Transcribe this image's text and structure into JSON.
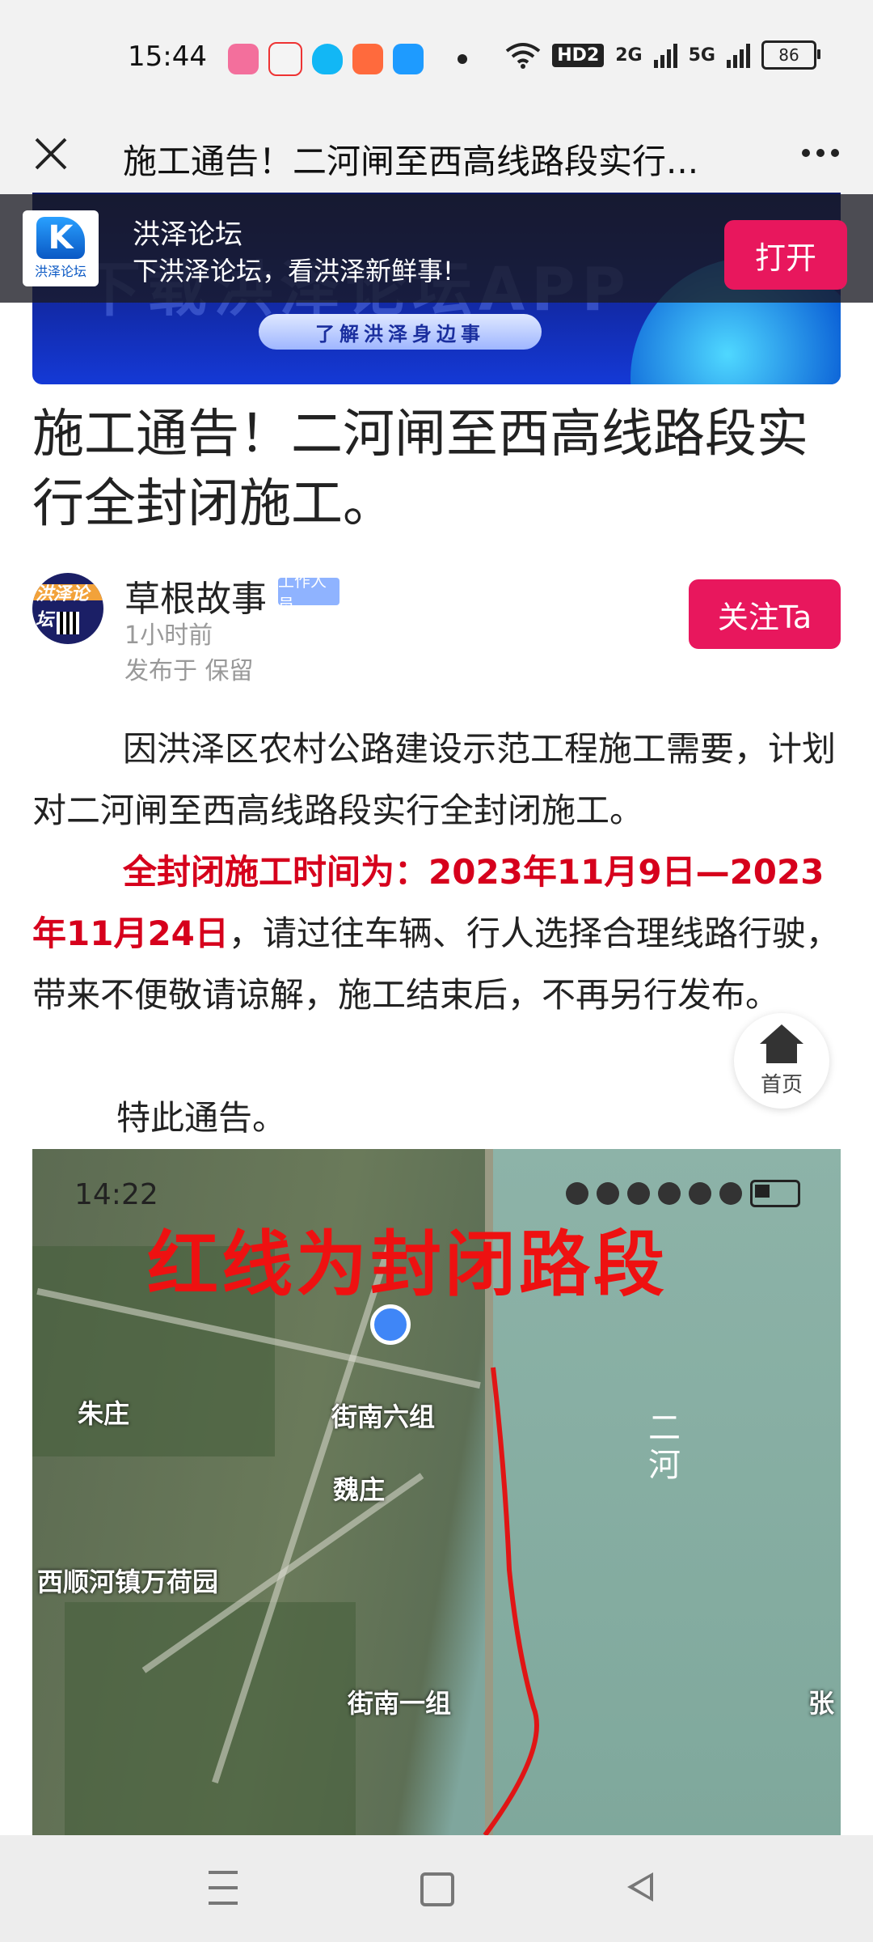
{
  "status_bar": {
    "time": "15:44",
    "hd_label": "HD2",
    "network_1": "2G",
    "network_2": "5G",
    "battery": "86",
    "app_icons": [
      "bilibili-icon",
      "notification-app-icon",
      "qq-icon",
      "photo-app-icon",
      "browser-app-icon"
    ]
  },
  "title_bar": {
    "title": "施工通告！二河闸至西高线路段实行..."
  },
  "promo": {
    "app_name": "洪泽论坛",
    "subtitle": "下洪泽论坛，看洪泽新鲜事!",
    "logo_text": "洪泽论坛",
    "open_label": "打开",
    "banner_text": "下载洪泽论坛APP",
    "banner_pill": "了解洪泽身边事"
  },
  "article": {
    "title": "施工通告！二河闸至西高线路段实行全封闭施工。",
    "author": "草根故事",
    "badge": "工作人员",
    "time": "1小时前",
    "location": "发布于 保留",
    "follow_label": "关注Ta",
    "paragraph1": "因洪泽区农村公路建设示范工程施工需要，计划对二河闸至西高线路段实行全封闭施工。",
    "paragraph2_red": "全封闭施工时间为：2023年11月9日—2023年11月24日",
    "paragraph2_rest": "，请过往车辆、行人选择合理线路行驶，带来不便敬请谅解，施工结束后，不再另行发布。",
    "paragraph3": "特此通告。",
    "home_label": "首页"
  },
  "map": {
    "time": "14:22",
    "headline": "红线为封闭路段",
    "labels": [
      "朱庄",
      "街南六组",
      "魏庄",
      "西顺河镇万荷园",
      "街南一组",
      "张"
    ],
    "river": "二河",
    "closed_road_color": "#e01515"
  },
  "colors": {
    "accent": "#e8175d",
    "notice_red": "#d6001c"
  }
}
